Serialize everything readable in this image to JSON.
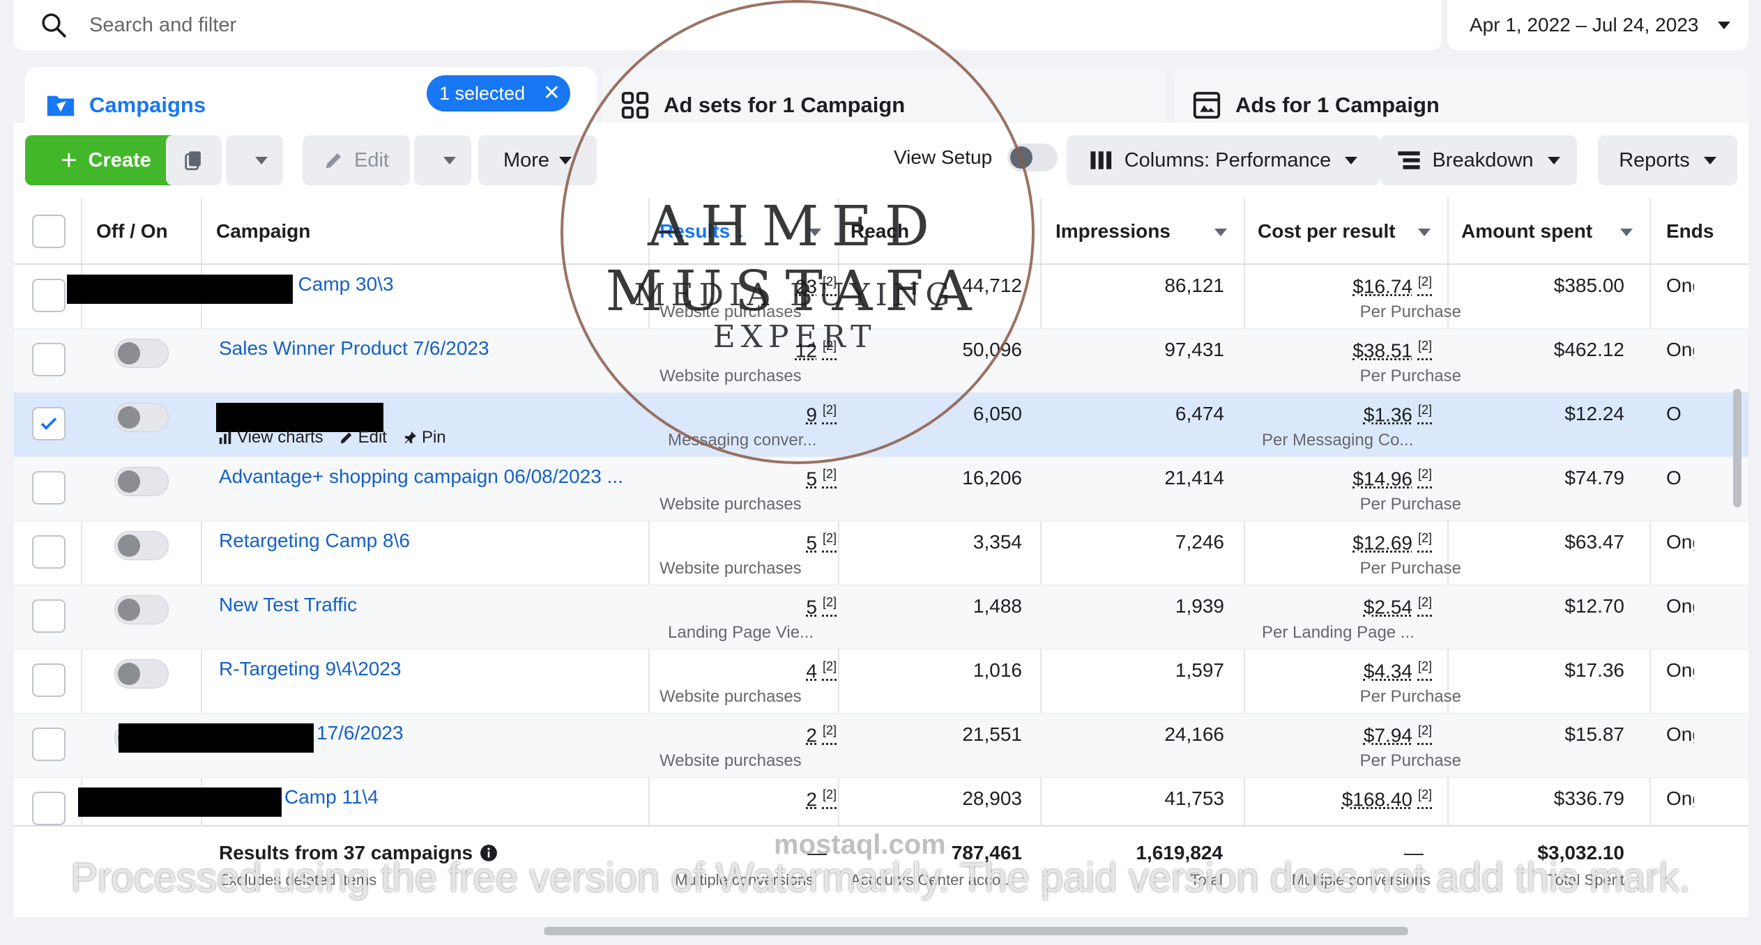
{
  "search": {
    "placeholder": "Search and filter"
  },
  "date_range": {
    "label": "Apr 1, 2022 – Jul 24, 2023"
  },
  "tabs": {
    "campaigns": "Campaigns",
    "selected_pill": "1 selected",
    "ad_sets": "Ad sets for 1 Campaign",
    "ads": "Ads for 1 Campaign"
  },
  "toolbar": {
    "create": "Create",
    "edit": "Edit",
    "more": "More",
    "view_setup": "View Setup",
    "columns": "Columns: Performance",
    "breakdown": "Breakdown",
    "reports": "Reports"
  },
  "columns": [
    "Off / On",
    "Campaign",
    "Results ↓",
    "Reach",
    "Impressions",
    "Cost per result",
    "Amount spent",
    "Ends"
  ],
  "row_actions": {
    "view_charts": "View charts",
    "edit": "Edit",
    "pin": "Pin"
  },
  "rows": [
    {
      "name": "t Camp 30\\3",
      "redacted": true,
      "results": "23",
      "result_type": "Website purchases",
      "reach": "44,712",
      "impressions": "86,121",
      "cost": "$16.74",
      "cost_type": "Per Purchase",
      "spent": "$385.00",
      "ends": "Ong",
      "selected": false
    },
    {
      "name": "Sales Winner Product 7/6/2023",
      "redacted": false,
      "results": "12",
      "result_type": "Website purchases",
      "reach": "50,096",
      "impressions": "97,431",
      "cost": "$38.51",
      "cost_type": "Per Purchase",
      "spent": "$462.12",
      "ends": "Ong",
      "selected": false
    },
    {
      "name": "",
      "redacted": true,
      "results": "9",
      "result_type": "Messaging conver...",
      "reach": "6,050",
      "impressions": "6,474",
      "cost": "$1.36",
      "cost_type": "Per Messaging Co...",
      "spent": "$12.24",
      "ends": "O",
      "selected": true
    },
    {
      "name": "Advantage+ shopping campaign 06/08/2023 ...",
      "redacted": false,
      "results": "5",
      "result_type": "Website purchases",
      "reach": "16,206",
      "impressions": "21,414",
      "cost": "$14.96",
      "cost_type": "Per Purchase",
      "spent": "$74.79",
      "ends": "O",
      "selected": false
    },
    {
      "name": "Retargeting Camp 8\\6",
      "redacted": false,
      "results": "5",
      "result_type": "Website purchases",
      "reach": "3,354",
      "impressions": "7,246",
      "cost": "$12.69",
      "cost_type": "Per Purchase",
      "spent": "$63.47",
      "ends": "Ong",
      "selected": false
    },
    {
      "name": "New Test Traffic",
      "redacted": false,
      "results": "5",
      "result_type": "Landing Page Vie...",
      "reach": "1,488",
      "impressions": "1,939",
      "cost": "$2.54",
      "cost_type": "Per Landing Page ...",
      "spent": "$12.70",
      "ends": "Ong",
      "selected": false
    },
    {
      "name": "R-Targeting 9\\4\\2023",
      "redacted": false,
      "results": "4",
      "result_type": "Website purchases",
      "reach": "1,016",
      "impressions": "1,597",
      "cost": "$4.34",
      "cost_type": "Per Purchase",
      "spent": "$17.36",
      "ends": "Ong",
      "selected": false
    },
    {
      "name": "17/6/2023",
      "redacted": true,
      "results": "2",
      "result_type": "Website purchases",
      "reach": "21,551",
      "impressions": "24,166",
      "cost": "$7.94",
      "cost_type": "Per Purchase",
      "spent": "$15.87",
      "ends": "Ong",
      "selected": false
    },
    {
      "name": "Camp 11\\4",
      "redacted": true,
      "results": "2",
      "result_type": "",
      "reach": "28,903",
      "impressions": "41,753",
      "cost": "$168.40",
      "cost_type": "",
      "spent": "$336.79",
      "ends": "Ong",
      "selected": false
    }
  ],
  "footnote_marker": "[2]",
  "footer": {
    "title": "Results from 37 campaigns",
    "subtitle": "Excludes deleted items",
    "results": "—",
    "results_sub": "Multiple conversions",
    "reach": "787,461",
    "reach_sub": "Accounts Center acco...",
    "impressions": "1,619,824",
    "impressions_sub": "Total",
    "cost": "—",
    "cost_sub": "Multiple conversions",
    "spent": "$3,032.10",
    "spent_sub": "Total Spent"
  },
  "watermark": {
    "title": "AHMED MUSTAFA",
    "line1": "MEDIA BUYING",
    "line2": "EXPERT",
    "banner": "Processed using the free version of Watermarkly. The paid version does not add this mark.",
    "stamp": "mostaql.com"
  },
  "colors": {
    "accent": "#1877f2",
    "create": "#42b72a",
    "link": "#1461c4",
    "selected_row": "#dbe8fc"
  }
}
